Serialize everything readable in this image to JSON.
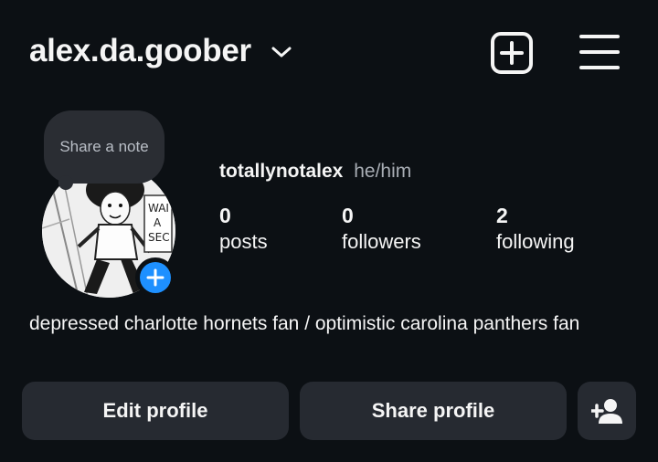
{
  "header": {
    "username": "alex.da.goober",
    "icons": [
      "chevron-down-icon",
      "new-post-icon",
      "hamburger-menu-icon"
    ]
  },
  "note": {
    "placeholder": "Share a note"
  },
  "profile": {
    "display_name": "totallynotalex",
    "pronouns": "he/him",
    "stats": [
      {
        "value": "0",
        "label": "posts"
      },
      {
        "value": "0",
        "label": "followers"
      },
      {
        "value": "2",
        "label": "following"
      }
    ],
    "bio": "depressed charlotte hornets fan / optimistic carolina panthers fan"
  },
  "actions": {
    "edit_label": "Edit profile",
    "share_label": "Share profile",
    "add_user_icon": "add-person-icon"
  },
  "colors": {
    "background": "#0c1014",
    "button": "#262a31",
    "accent_blue": "#1e90ff",
    "secondary_text": "#a8adb4"
  }
}
